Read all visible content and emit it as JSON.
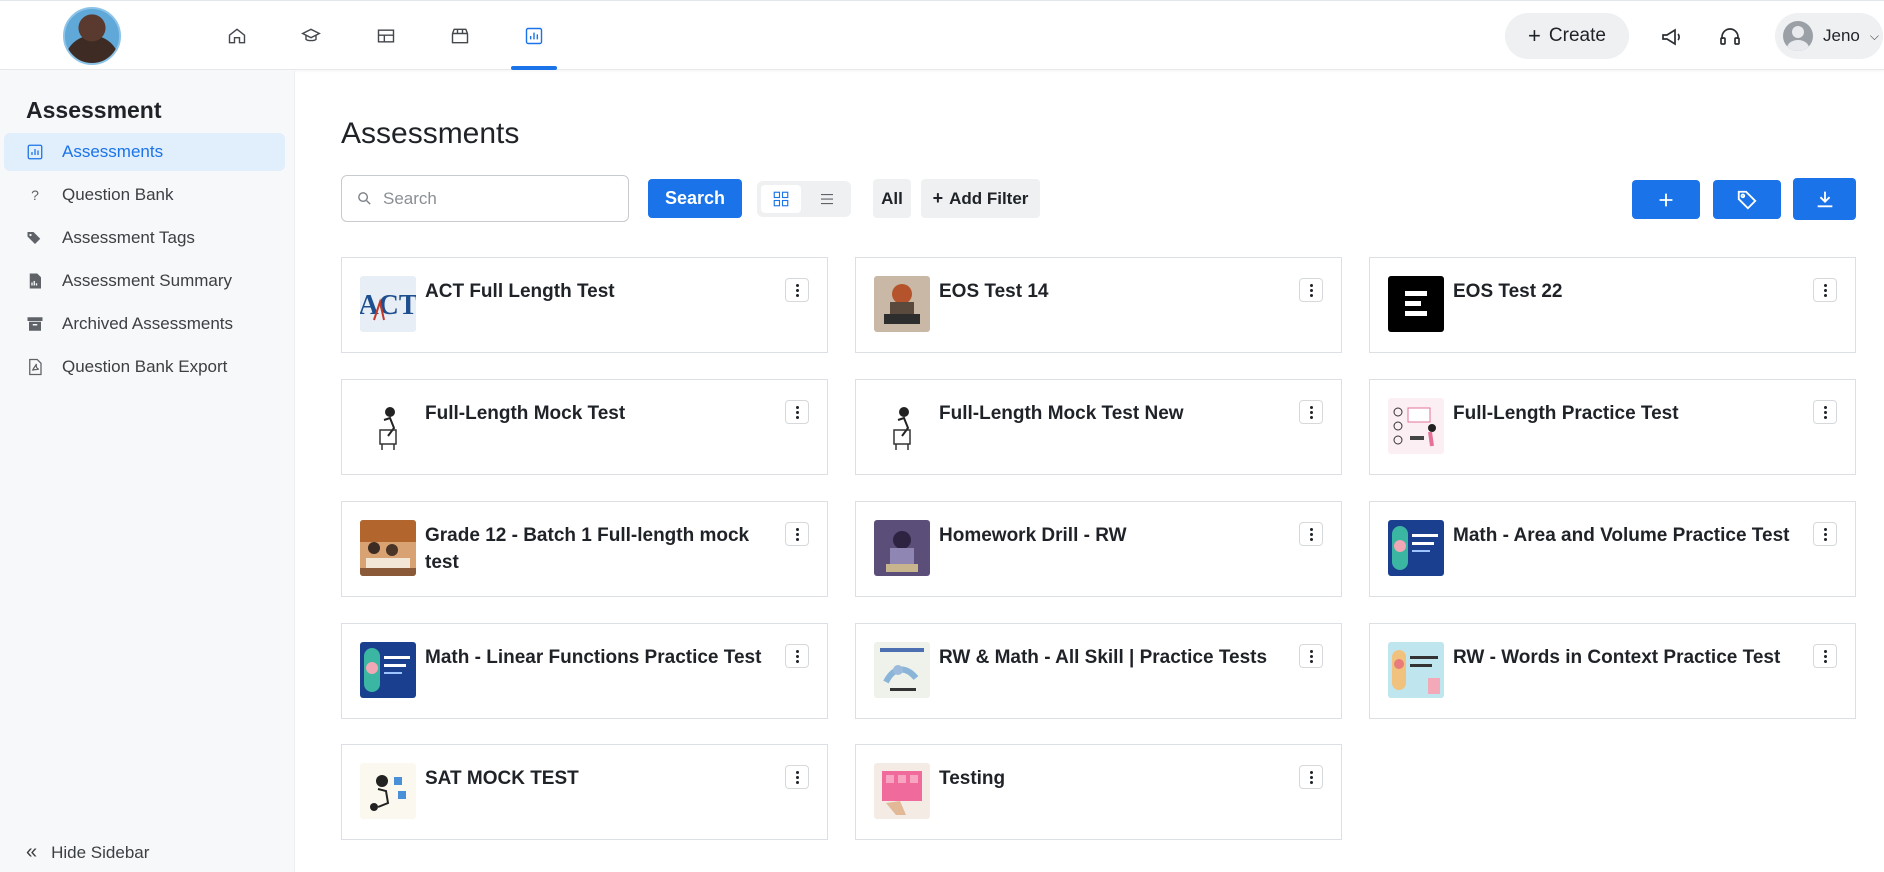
{
  "topbar": {
    "nav_icons": [
      "home-icon",
      "graduation-cap-icon",
      "dashboard-icon",
      "store-icon",
      "bar-chart-icon"
    ],
    "active_nav": "bar-chart-icon",
    "create_label": "Create",
    "user_name": "Jeno",
    "accent_color": "#1a73e8"
  },
  "sidebar": {
    "title": "Assessment",
    "items": [
      {
        "label": "Assessments",
        "icon": "bar-chart-icon",
        "active": true
      },
      {
        "label": "Question Bank",
        "icon": "question-icon"
      },
      {
        "label": "Assessment Tags",
        "icon": "tags-icon"
      },
      {
        "label": "Assessment Summary",
        "icon": "document-chart-icon"
      },
      {
        "label": "Archived Assessments",
        "icon": "archive-icon"
      },
      {
        "label": "Question Bank Export",
        "icon": "pdf-file-icon"
      }
    ],
    "hide_label": "Hide Sidebar"
  },
  "main": {
    "title": "Assessments",
    "search": {
      "placeholder": "Search",
      "value": "",
      "button_label": "Search"
    },
    "filter": {
      "all_label": "All",
      "add_filter_label": "Add Filter"
    },
    "actions": [
      "plus-icon",
      "tag-icon",
      "download-icon"
    ],
    "cards": [
      {
        "title": "ACT Full Length Test",
        "thumb": "act"
      },
      {
        "title": "EOS Test 14",
        "thumb": "photo-desk"
      },
      {
        "title": "EOS Test 22",
        "thumb": "logo-black"
      },
      {
        "title": "Full-Length Mock Test",
        "thumb": "sketch"
      },
      {
        "title": "Full-Length Mock Test New",
        "thumb": "sketch"
      },
      {
        "title": "Full-Length Practice Test",
        "thumb": "illustration-pink"
      },
      {
        "title": "Grade 12 - Batch 1 Full-length mock test",
        "thumb": "photo-classroom"
      },
      {
        "title": "Homework Drill - RW",
        "thumb": "illustration-purple"
      },
      {
        "title": "Math - Area and Volume Practice Test",
        "thumb": "blue-poster"
      },
      {
        "title": "Math - Linear Functions Practice Test",
        "thumb": "blue-poster"
      },
      {
        "title": "RW & Math - All Skill | Practice Tests",
        "thumb": "reading-writing"
      },
      {
        "title": "RW - Words in Context Practice Test",
        "thumb": "cyan-poster"
      },
      {
        "title": "SAT MOCK TEST",
        "thumb": "sketch-color"
      },
      {
        "title": "Testing",
        "thumb": "photo-pink"
      }
    ]
  }
}
